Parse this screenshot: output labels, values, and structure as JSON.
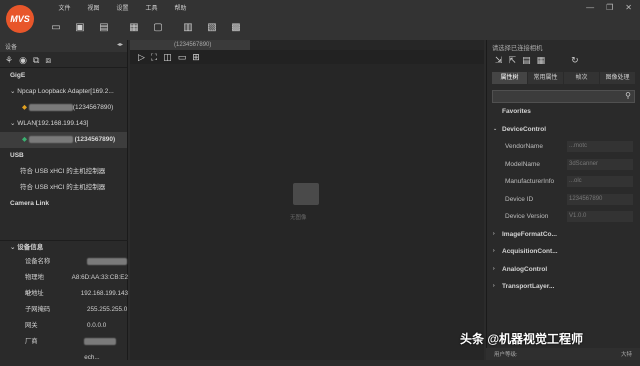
{
  "app": {
    "logo": "MVS"
  },
  "menu": [
    "文件",
    "视图",
    "设置",
    "工具",
    "帮助"
  ],
  "window_buttons": [
    "—",
    "❐",
    "✕"
  ],
  "left_panel": {
    "title": "设备",
    "tree": [
      {
        "label": "GigE",
        "type": "cat"
      },
      {
        "label": "Npcap Loopback Adapter[169.2...",
        "type": "sub"
      },
      {
        "label": "(1234567890)",
        "type": "device"
      },
      {
        "label": "WLAN[192.168.199.143]",
        "type": "sub"
      },
      {
        "label": "(1234567890)",
        "type": "device-selected"
      },
      {
        "label": "USB",
        "type": "cat"
      },
      {
        "label": "符合 USB xHCI 的主机控制器",
        "type": "sub2"
      },
      {
        "label": "符合 USB xHCI 的主机控制器",
        "type": "sub2"
      },
      {
        "label": "Camera Link",
        "type": "cat"
      }
    ],
    "info_header": "设备信息",
    "info": [
      {
        "k": "设备名称",
        "v": ""
      },
      {
        "k": "物理地址",
        "v": "A8:6D:AA:33:CB:E2"
      },
      {
        "k": "IP地址",
        "v": "192.168.199.143"
      },
      {
        "k": "子网掩码",
        "v": "255.255.255.0"
      },
      {
        "k": "网关",
        "v": "0.0.0.0"
      },
      {
        "k": "厂商",
        "v": "ech..."
      }
    ]
  },
  "center": {
    "tab": "(1234567890)",
    "placeholder": "无图像"
  },
  "right_panel": {
    "title": "请选择已连接相机",
    "tabs": [
      "属性树",
      "常用属性",
      "帧次",
      "图像处理"
    ],
    "props": [
      {
        "label": "Favorites",
        "kind": "cat"
      },
      {
        "label": "DeviceControl",
        "kind": "open"
      },
      {
        "label": "VendorName",
        "kind": "item",
        "value": "...motc"
      },
      {
        "label": "ModelName",
        "kind": "item",
        "value": "3dScanner"
      },
      {
        "label": "ManufacturerInfo",
        "kind": "item",
        "value": "...olc"
      },
      {
        "label": "Device ID",
        "kind": "item",
        "value": "1234567890"
      },
      {
        "label": "Device Version",
        "kind": "item",
        "value": "V1.0.0"
      },
      {
        "label": "ImageFormatCo...",
        "kind": "closed"
      },
      {
        "label": "AcquisitionCont...",
        "kind": "closed"
      },
      {
        "label": "AnalogControl",
        "kind": "closed"
      },
      {
        "label": "TransportLayer...",
        "kind": "closed"
      }
    ],
    "status_left": "用户等级:",
    "status_right": "大特"
  },
  "watermark": "头条 @机器视觉工程师"
}
